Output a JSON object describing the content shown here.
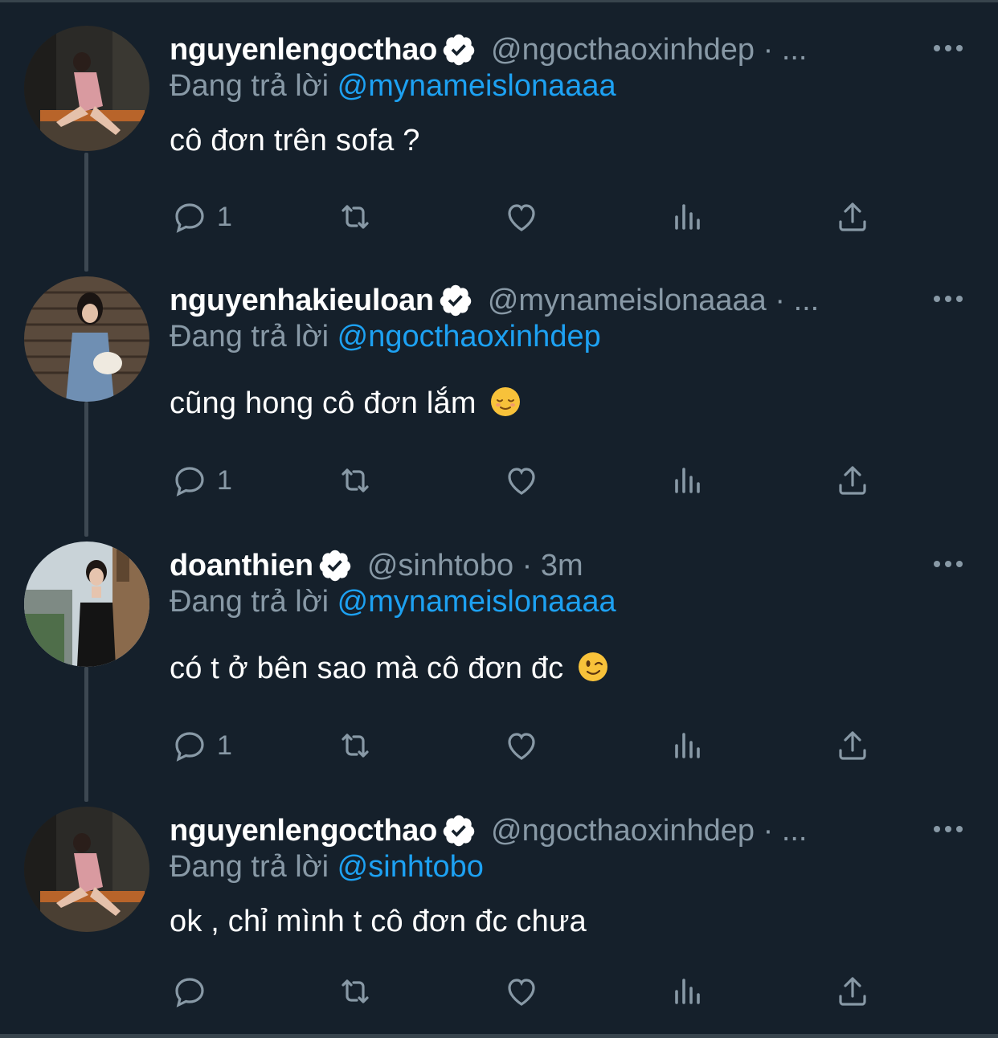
{
  "colors": {
    "background": "#15202b",
    "secondary_text": "#8899a6",
    "mention": "#1da1f2",
    "divider": "#38444d"
  },
  "tweets": [
    {
      "name": "nguyenlengocthao",
      "handle": "@ngocthaoxinhdep · ...",
      "reply_prefix": "Đang trả lời",
      "reply_mention": "@mynameislonaaaa",
      "text": "cô đơn trên sofa ?",
      "emoji": "",
      "reply_count": "1",
      "avatar": "woman-on-sofa-photo"
    },
    {
      "name": "nguyenhakieuloan",
      "handle": "@mynameislonaaaa · ...",
      "reply_prefix": "Đang trả lời",
      "reply_mention": "@ngocthaoxinhdep",
      "text": "cũng hong cô đơn lắm",
      "emoji": "relieved-face",
      "reply_count": "1",
      "avatar": "woman-with-handbag-photo"
    },
    {
      "name": "doanthien",
      "handle": "@sinhtobo · 3m",
      "reply_prefix": "Đang trả lời",
      "reply_mention": "@mynameislonaaaa",
      "text": "có t ở bên sao mà cô đơn đc",
      "emoji": "winking-face",
      "reply_count": "1",
      "avatar": "woman-by-street-photo"
    },
    {
      "name": "nguyenlengocthao",
      "handle": "@ngocthaoxinhdep · ...",
      "reply_prefix": "Đang trả lời",
      "reply_mention": "@sinhtobo",
      "text": "ok , chỉ mình t cô đơn đc chưa",
      "emoji": "",
      "reply_count": "",
      "avatar": "woman-on-sofa-photo"
    }
  ]
}
